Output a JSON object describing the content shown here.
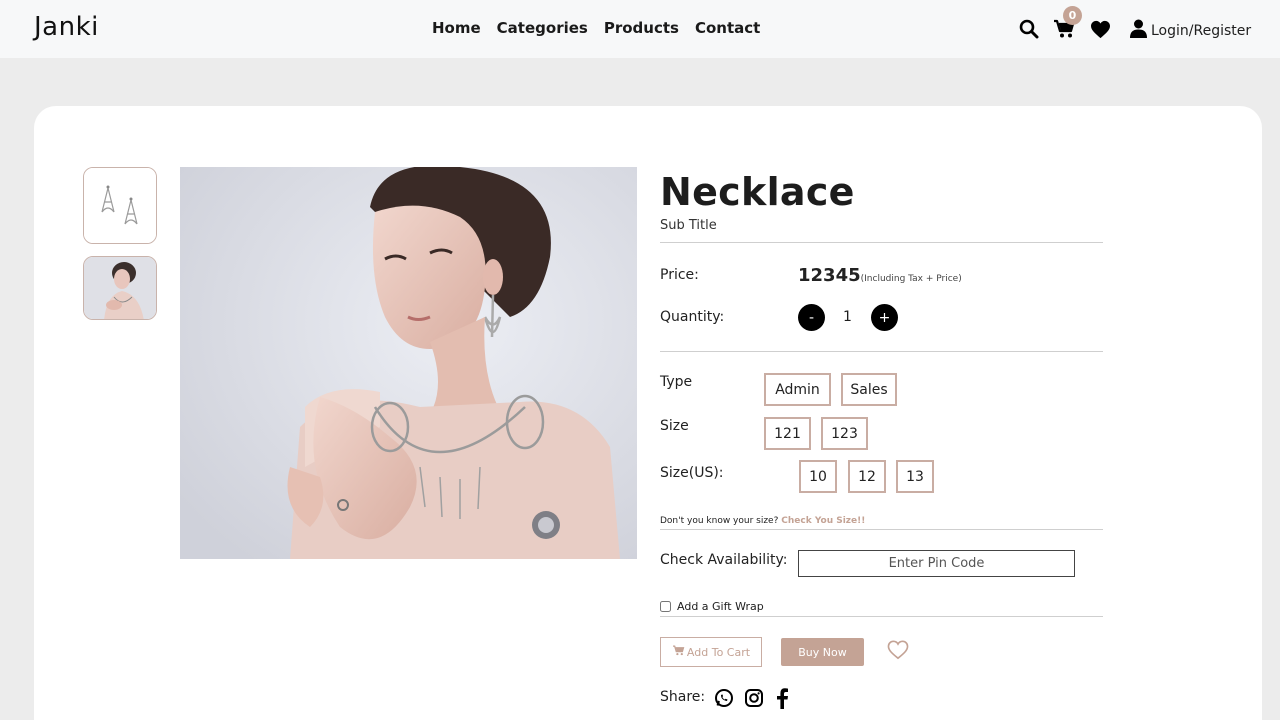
{
  "header": {
    "logo": "Janki",
    "nav": [
      "Home",
      "Categories",
      "Products",
      "Contact"
    ],
    "cart_count": "0",
    "login_label": "Login/Register"
  },
  "product": {
    "title": "Necklace",
    "subtitle": "Sub Title",
    "price_label": "Price:",
    "price": "12345",
    "price_note": "(Including Tax + Price)",
    "quantity_label": "Quantity:",
    "quantity": "1",
    "minus": "-",
    "plus": "+",
    "type_label": "Type",
    "types": [
      "Admin",
      "Sales"
    ],
    "size_label": "Size",
    "sizes": [
      "121",
      "123"
    ],
    "size_us_label": "Size(US):",
    "sizes_us": [
      "10",
      "12",
      "13"
    ],
    "size_hint": "Don't you know your size?",
    "size_hint_link": "Check You Size!!",
    "availability_label": "Check Availability:",
    "pin_placeholder": "Enter Pin Code",
    "gift_wrap_label": "Add a Gift Wrap",
    "add_to_cart": "Add To Cart",
    "buy_now": "Buy Now",
    "share_label": "Share:"
  },
  "colors": {
    "accent": "#c4a395",
    "header_bg": "#f7f8f9",
    "page_bg": "#ececec"
  },
  "icons": [
    "search-icon",
    "cart-icon",
    "heart-icon",
    "user-icon",
    "whatsapp-icon",
    "instagram-icon",
    "facebook-icon"
  ]
}
